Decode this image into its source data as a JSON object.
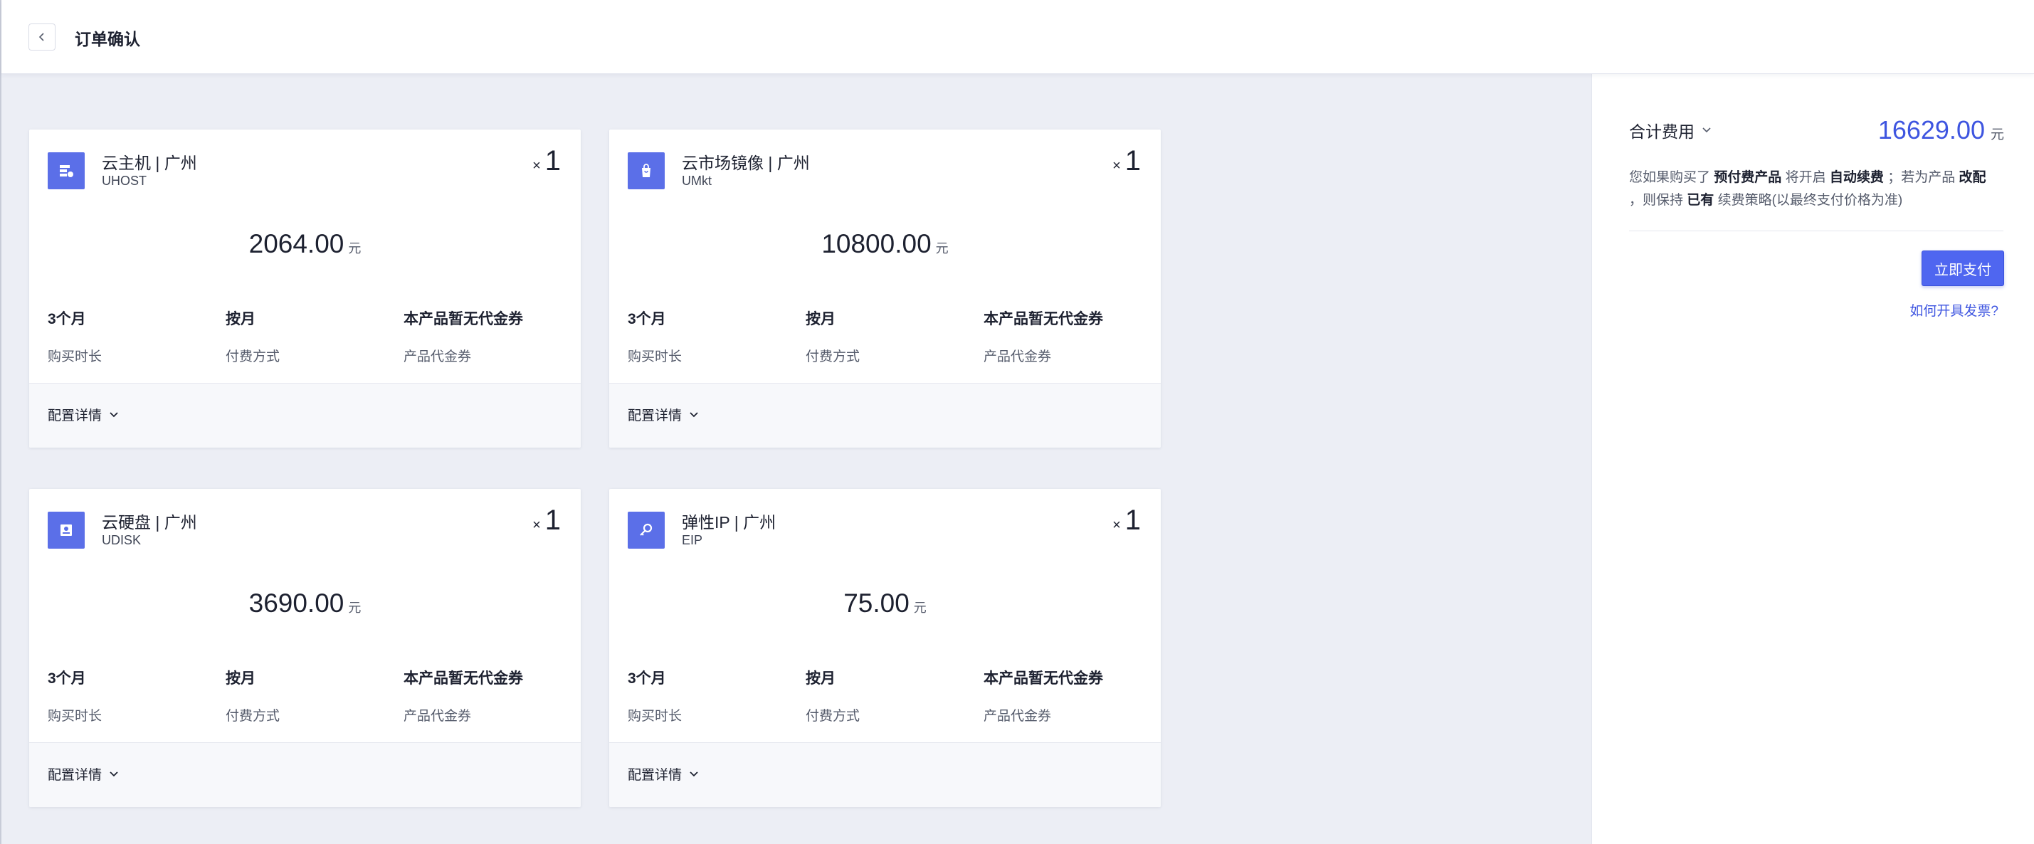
{
  "header": {
    "title": "订单确认"
  },
  "cards": [
    {
      "title": "云主机 | 广州",
      "code": "UHOST",
      "qty_x": "×",
      "qty": "1",
      "price": "2064.00",
      "unit": "元",
      "duration_value": "3个月",
      "duration_label": "购买时长",
      "payment_value": "按月",
      "payment_label": "付费方式",
      "voucher_value": "本产品暂无代金券",
      "voucher_label": "产品代金券",
      "config_label": "配置详情",
      "icon": "server-icon"
    },
    {
      "title": "云市场镜像 | 广州",
      "code": "UMkt",
      "qty_x": "×",
      "qty": "1",
      "price": "10800.00",
      "unit": "元",
      "duration_value": "3个月",
      "duration_label": "购买时长",
      "payment_value": "按月",
      "payment_label": "付费方式",
      "voucher_value": "本产品暂无代金券",
      "voucher_label": "产品代金券",
      "config_label": "配置详情",
      "icon": "shopping-bag-icon"
    },
    {
      "title": "云硬盘 | 广州",
      "code": "UDISK",
      "qty_x": "×",
      "qty": "1",
      "price": "3690.00",
      "unit": "元",
      "duration_value": "3个月",
      "duration_label": "购买时长",
      "payment_value": "按月",
      "payment_label": "付费方式",
      "voucher_value": "本产品暂无代金券",
      "voucher_label": "产品代金券",
      "config_label": "配置详情",
      "icon": "disk-icon"
    },
    {
      "title": "弹性IP | 广州",
      "code": "EIP",
      "qty_x": "×",
      "qty": "1",
      "price": "75.00",
      "unit": "元",
      "duration_value": "3个月",
      "duration_label": "购买时长",
      "payment_value": "按月",
      "payment_label": "付费方式",
      "voucher_value": "本产品暂无代金券",
      "voucher_label": "产品代金券",
      "config_label": "配置详情",
      "icon": "ip-key-icon"
    }
  ],
  "summary": {
    "total_label": "合计费用",
    "total_amount": "16629.00",
    "total_unit": "元",
    "notice": {
      "p1": "您如果购买了",
      "b1": "预付费产品",
      "p2": "将开启",
      "b2": "自动续费",
      "p3": "；若为产品",
      "b3": "改配",
      "p4": "，则保持",
      "b4": "已有",
      "p5": "续费策略(以最终支付价格为准)"
    },
    "pay_button": "立即支付",
    "invoice_link": "如何开具发票?"
  },
  "colors": {
    "accent": "#4f66f0",
    "price_blue": "#3e55e0",
    "background": "#eceef5",
    "icon_bg": "#5b6fe8"
  }
}
